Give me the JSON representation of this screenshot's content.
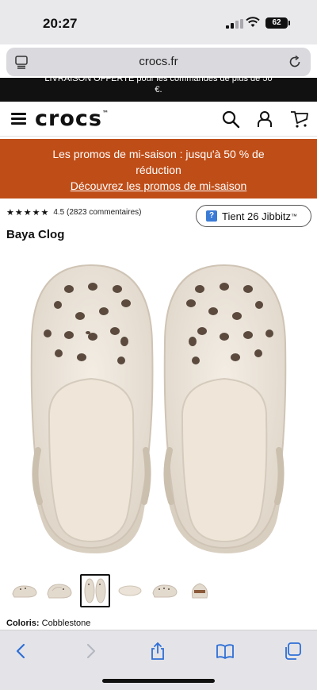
{
  "status": {
    "time": "20:27",
    "battery": "62"
  },
  "browser": {
    "url": "crocs.fr"
  },
  "top_banner": {
    "line1": "LIVRAISON OFFERTE pour les commandes de plus de 50",
    "line2": "€."
  },
  "header": {
    "logo": "crocs",
    "logo_mark": "™"
  },
  "promo": {
    "text": "Les promos de mi-saison : jusqu'à 50 % de réduction",
    "link": "Découvrez les promos de mi-saison"
  },
  "product": {
    "stars": "★★★★★",
    "rating_text": "4.5 (2823 commentaires)",
    "jibbitz_label": "Tient 26 Jibbitz",
    "jibbitz_mark": "™",
    "title": "Baya Clog",
    "colour_label": "Coloris:",
    "colour_value": "Cobblestone"
  },
  "colors": {
    "promo_bg": "#bf4d17",
    "clog": "#e9e1d6",
    "toolbar_icon": "#2f6fd6"
  }
}
